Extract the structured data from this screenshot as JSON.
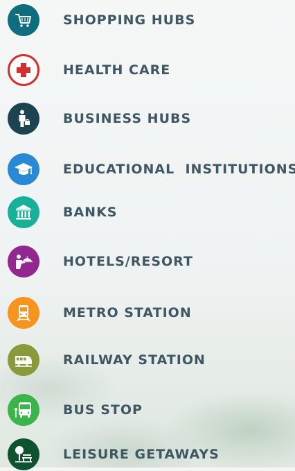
{
  "amenities": [
    {
      "label": "SHOPPING HUBS",
      "icon": "shopping-cart-icon",
      "color": "#0e6e7e"
    },
    {
      "label": "HEALTH CARE",
      "icon": "medical-cross-icon",
      "color": "#d32f2f"
    },
    {
      "label": "BUSINESS HUBS",
      "icon": "businessman-icon",
      "color": "#1d4250"
    },
    {
      "label": "EDUCATIONAL  INSTITUTIONS",
      "icon": "graduation-cap-icon",
      "color": "#2a89d4"
    },
    {
      "label": "BANKS",
      "icon": "bank-icon",
      "color": "#19b09a"
    },
    {
      "label": "HOTELS/RESORT",
      "icon": "hotel-service-icon",
      "color": "#92278f"
    },
    {
      "label": "METRO STATION",
      "icon": "metro-train-icon",
      "color": "#f7941d"
    },
    {
      "label": "RAILWAY STATION",
      "icon": "railway-train-icon",
      "color": "#8a9a3a"
    },
    {
      "label": "BUS STOP",
      "icon": "bus-icon",
      "color": "#39b54a"
    },
    {
      "label": "LEISURE GETAWAYS",
      "icon": "park-bench-icon",
      "color": "#0f5232"
    }
  ]
}
